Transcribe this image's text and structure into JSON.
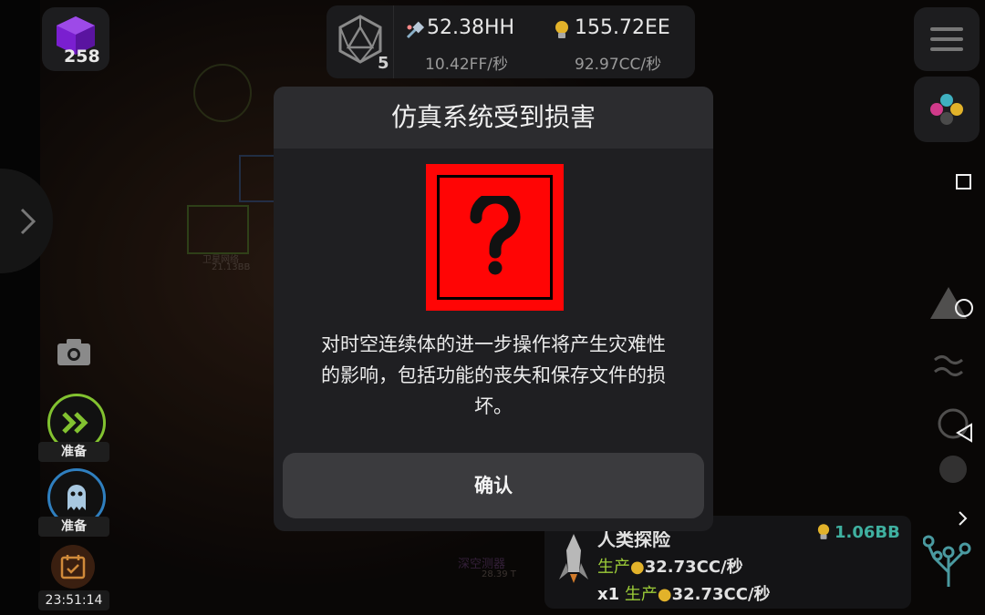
{
  "top_bar": {
    "dice_count": "5",
    "resource_left_value": "52.38HH",
    "resource_left_rate": "10.42FF/秒",
    "resource_right_value": "155.72EE",
    "resource_right_rate": "92.97CC/秒"
  },
  "left_panel": {
    "gem_count": "258",
    "ability1_label": "准备",
    "ability2_label": "准备",
    "clock": "23:51:14"
  },
  "probe_card": {
    "title": "人类探险",
    "income": "1.06BB",
    "line1_key": "生产",
    "line1_value": "32.73CC/秒",
    "line2_multiplier": "x1",
    "line2_key": "生产",
    "line2_value": "32.73CC/秒"
  },
  "modal": {
    "title": "仿真系统受到损害",
    "message_line1": "对时空连续体的进一步操作将产生灾难性",
    "message_line2": "的影响，包括功能的丧失和保存文件的损",
    "message_line3": "坏。",
    "confirm_label": "确认"
  },
  "background_labels": {
    "node1": "卫星网络",
    "node1_value": "21.13BB",
    "node2": "深空测器",
    "node2_value": "28.39 T"
  },
  "colors": {
    "warning_red": "#ff0505",
    "ready_green": "#82c230",
    "ghost_blue": "#2f7fbf",
    "income_teal": "#3fb0a0"
  },
  "icons": [
    "gem-icon",
    "d20-icon",
    "satellite-icon",
    "lightbulb-icon",
    "menu-icon",
    "color-palette-icon",
    "camera-icon",
    "fast-forward-icon",
    "ghost-icon",
    "calendar-icon",
    "chevron-right-icon",
    "question-mark-icon",
    "rocket-icon",
    "tech-tree-icon"
  ]
}
